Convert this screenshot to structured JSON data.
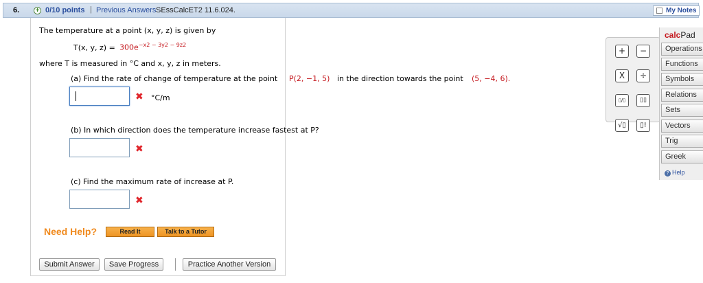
{
  "header": {
    "number": "6.",
    "points": "0/10 points",
    "separator": "|",
    "previous_answers": "Previous Answers",
    "code": "SEssCalcET2 11.6.024.",
    "my_notes": "My Notes"
  },
  "question": {
    "intro": "The temperature at a point (x, y, z) is given by",
    "formula_lhs": "T(x, y, z) = ",
    "formula_rhs": "300e−x2 − 3y2 − 9z2",
    "where": "where T is measured in °C and  x, y, z  in meters.",
    "part_a_prefix": "(a) Find the rate of change of temperature at the point",
    "part_a_point": "P(2, −1, 5)",
    "part_a_mid": "in the direction towards the point",
    "part_a_target": "(5, −4, 6).",
    "part_a_unit": "°C/m",
    "part_b": "(b) In which direction does the temperature increase fastest at P?",
    "part_c": "(c) Find the maximum rate of increase at P.",
    "answer_a": "",
    "answer_b": "",
    "answer_c": "",
    "incorrect_mark": "✖"
  },
  "help": {
    "need_help": "Need Help?",
    "read_it": "Read It",
    "talk_to_tutor": "Talk to a Tutor"
  },
  "actions": {
    "submit": "Submit Answer",
    "save": "Save Progress",
    "practice": "Practice Another Version"
  },
  "calcpad": {
    "title_a": "calc",
    "title_b": "Pad",
    "keys": [
      "+",
      "−",
      "X",
      "÷",
      "▯/▯",
      "▯▯",
      "√▯",
      "▯!"
    ],
    "tabs": [
      "Operations",
      "Functions",
      "Symbols",
      "Relations",
      "Sets",
      "Vectors",
      "Trig",
      "Greek"
    ],
    "help": "Help",
    "icon_names": {
      "help": "help-circle-icon",
      "incorrect": "x-mark-icon"
    }
  }
}
